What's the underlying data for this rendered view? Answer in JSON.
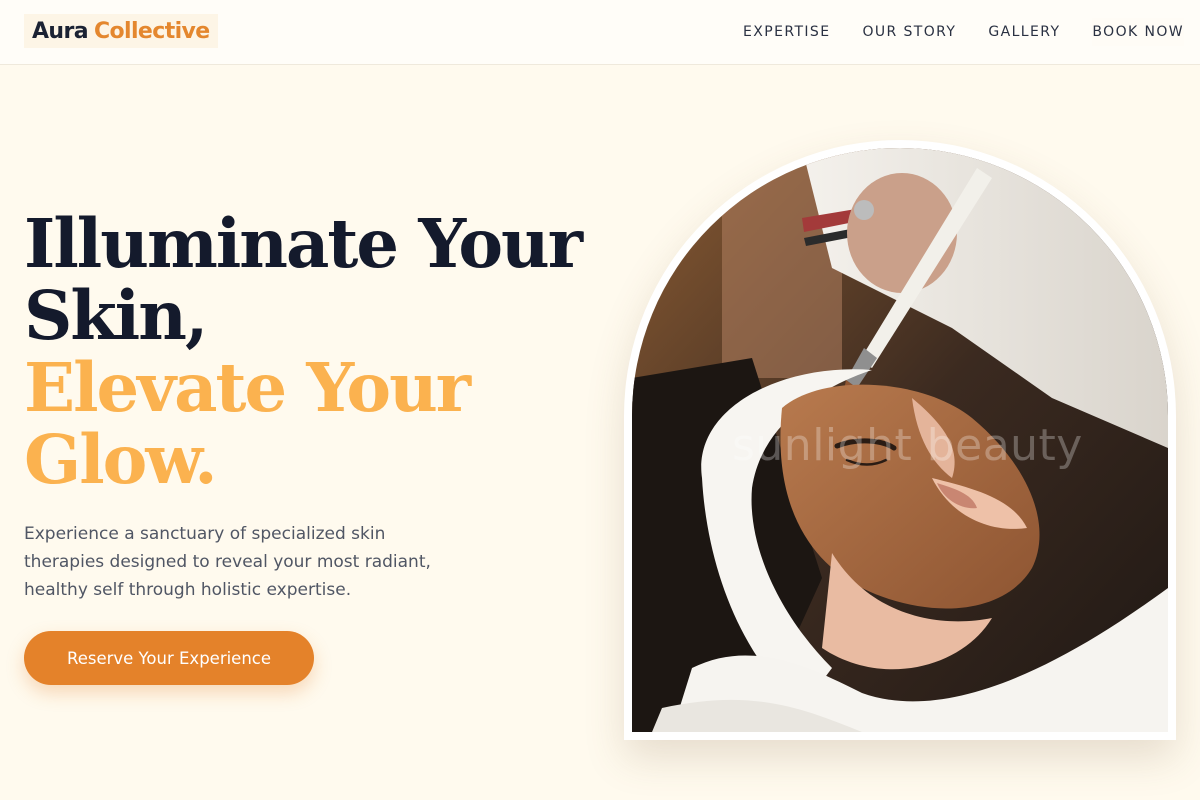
{
  "brand": {
    "name_part1": "Aura",
    "name_part2": "Collective",
    "accent_color": "#e4872e"
  },
  "nav": {
    "items": [
      {
        "label": "EXPERTISE"
      },
      {
        "label": "OUR STORY"
      },
      {
        "label": "GALLERY"
      },
      {
        "label": "BOOK NOW"
      }
    ]
  },
  "hero": {
    "headline_line1": "Illuminate Your",
    "headline_line2": "Skin,",
    "headline_line3": "Elevate Your",
    "headline_line4": "Glow.",
    "description": "Experience a sanctuary of specialized skin therapies designed to reveal your most radiant, healthy self through holistic expertise.",
    "cta_label": "Reserve Your Experience",
    "headline_color": "#141a2c",
    "headline_accent_color": "#fbb24f",
    "cta_color": "#e4822a",
    "image_watermark": "sunlight beauty"
  }
}
